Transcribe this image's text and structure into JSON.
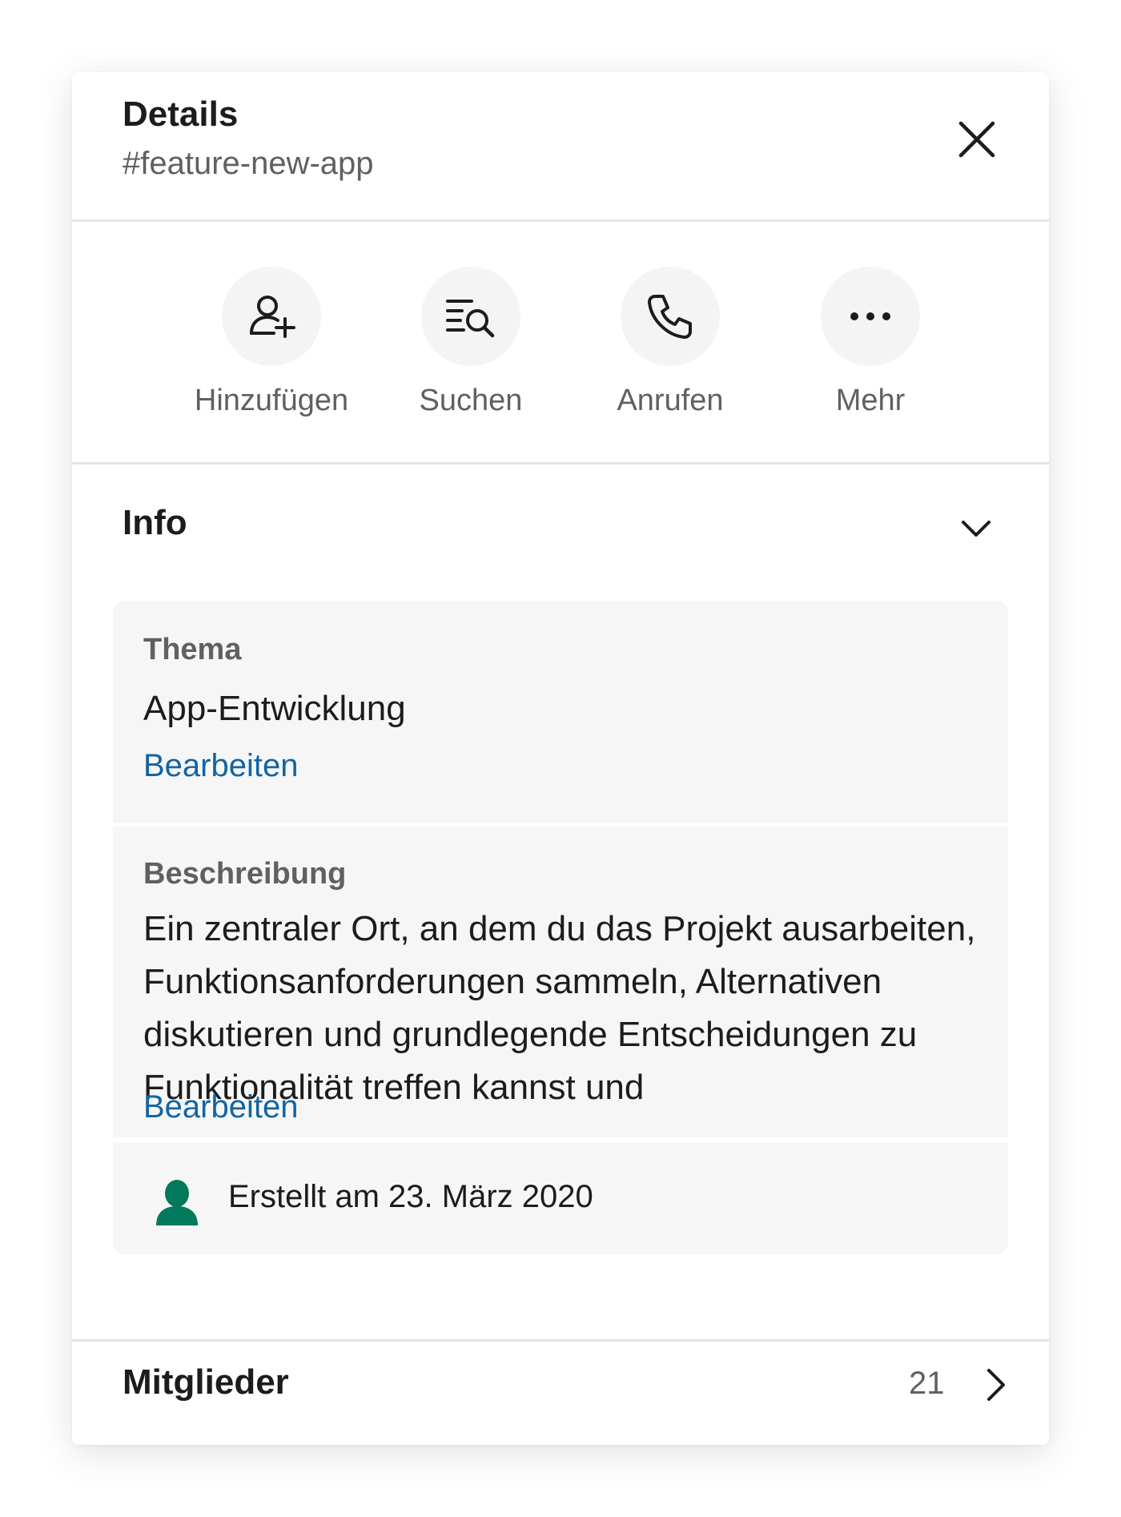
{
  "header": {
    "title": "Details",
    "channel": "#feature-new-app",
    "close_icon": "close-icon"
  },
  "actions": [
    {
      "label": "Hinzufügen",
      "icon": "add-person-icon"
    },
    {
      "label": "Suchen",
      "icon": "search-list-icon"
    },
    {
      "label": "Anrufen",
      "icon": "phone-icon"
    },
    {
      "label": "Mehr",
      "icon": "more-dots-icon"
    }
  ],
  "info": {
    "title": "Info",
    "topic": {
      "label": "Thema",
      "value": "App-Entwicklung",
      "edit_label": "Bearbeiten"
    },
    "description": {
      "label": "Beschreibung",
      "lines": [
        "Ein zentraler Ort, an dem du das Projekt ausarbeiten,",
        "Funktionsanforderungen sammeln, Alternativen",
        "diskutieren und grundlegende Entscheidungen zu",
        "Funktionalität treffen kannst und"
      ],
      "edit_label": "Bearbeiten"
    },
    "created": {
      "text": "Erstellt am 23. März 2020",
      "icon": "person-icon"
    }
  },
  "members": {
    "label": "Mitglieder",
    "count": "21"
  },
  "colors": {
    "link": "#1264a3",
    "person_icon": "#007a5a",
    "muted_text": "#616061",
    "card_bg": "#f6f6f6"
  }
}
